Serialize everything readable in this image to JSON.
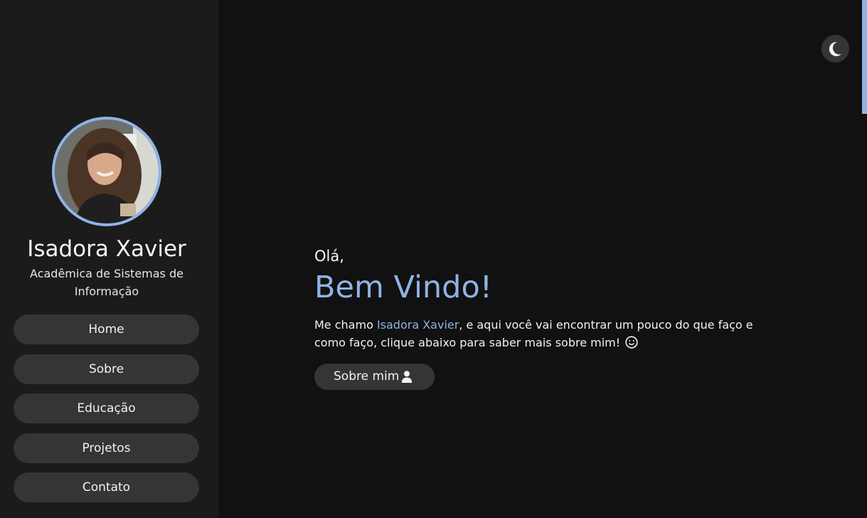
{
  "profile": {
    "name": "Isadora Xavier",
    "subtitle": "Acadêmica de Sistemas de Informação",
    "avatar_icon": "profile-photo"
  },
  "nav": {
    "items": [
      {
        "label": "Home"
      },
      {
        "label": "Sobre"
      },
      {
        "label": "Educação"
      },
      {
        "label": "Projetos"
      },
      {
        "label": "Contato"
      }
    ]
  },
  "theme_toggle": {
    "icon": "moon-icon"
  },
  "hero": {
    "greeting": "Olá,",
    "title": "Bem Vindo!",
    "intro_prefix": "Me chamo ",
    "intro_name": "Isadora Xavier",
    "intro_suffix": ", e aqui você vai encontrar um pouco do que faço e como faço, clique abaixo para saber mais sobre mim!",
    "intro_emoji_icon": "smile-icon",
    "cta_label": "Sobre mim",
    "cta_icon": "user-icon"
  },
  "colors": {
    "background": "#111111",
    "sidebar": "#1b1b1b",
    "button": "#353535",
    "accent": "#8fb3e6",
    "text": "#f2f2f2"
  }
}
